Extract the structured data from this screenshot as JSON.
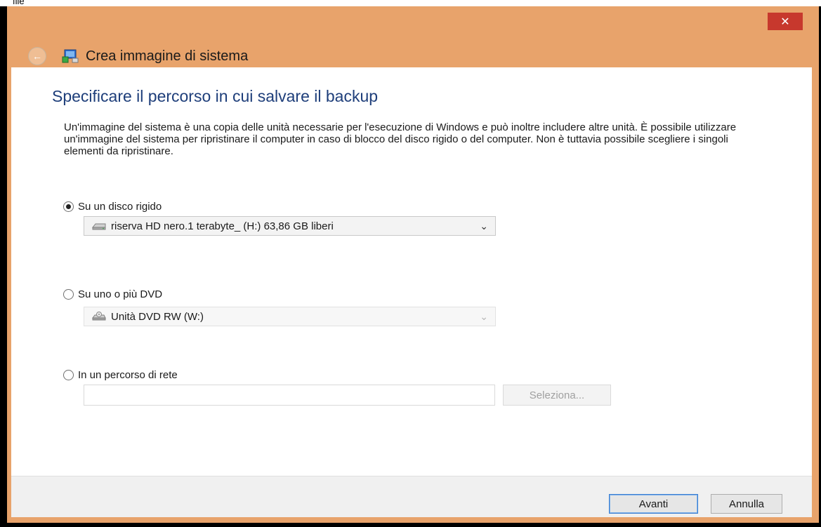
{
  "window": {
    "top_text": "file",
    "close_glyph": "✕",
    "back_glyph": "←",
    "app_icon": "system-backup-icon",
    "title": "Crea immagine di sistema"
  },
  "page": {
    "heading": "Specificare il percorso in cui salvare il backup",
    "description": "Un'immagine del sistema è una copia delle unità necessarie per l'esecuzione di Windows e può inoltre includere altre unità. È possibile utilizzare un'immagine del sistema per ripristinare il computer in caso di blocco del disco rigido o del computer. Non è tuttavia possibile scegliere i singoli elementi da ripristinare."
  },
  "options": {
    "hard_disk": {
      "label": "Su un disco rigido",
      "checked": true,
      "selected_value": "riserva HD nero.1 terabyte_ (H:)  63,86 GB liberi",
      "icon": "hard-drive-icon"
    },
    "dvd": {
      "label": "Su uno o più DVD",
      "checked": false,
      "selected_value": "Unità DVD RW (W:)",
      "icon": "dvd-drive-icon"
    },
    "network": {
      "label": "In un percorso di rete",
      "checked": false,
      "path_value": "",
      "browse_label": "Seleziona..."
    }
  },
  "footer": {
    "next_label": "Avanti",
    "cancel_label": "Annulla"
  },
  "colors": {
    "frame": "#e8a36b",
    "heading": "#1e3e7a",
    "close": "#c7382d",
    "primary_border": "#3c7fd1"
  }
}
